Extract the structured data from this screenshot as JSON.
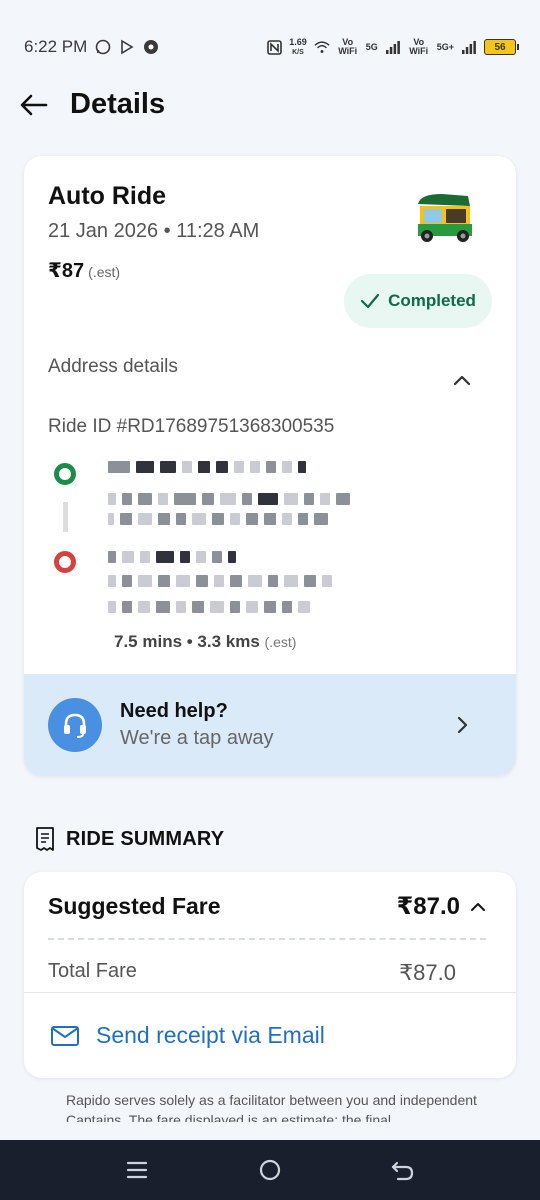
{
  "status_bar": {
    "time": "6:22 PM",
    "net_speed_value": "1.69",
    "net_speed_unit": "K/S",
    "sim1_label": "Vo WiFi",
    "sim1_network": "5G",
    "sim2_label": "Vo WiFi",
    "sim2_network": "5G+",
    "battery": "56"
  },
  "header": {
    "title": "Details"
  },
  "ride": {
    "type": "Auto Ride",
    "datetime": "21 Jan 2026 • 11:28 AM",
    "price": "₹87",
    "price_note": "(.est)",
    "status": "Completed",
    "address_label": "Address details",
    "ride_id": "Ride ID #RD17689751368300535",
    "duration_distance": "7.5 mins • 3.3 kms",
    "duration_note": "(.est)"
  },
  "help": {
    "title": "Need help?",
    "subtitle": "We're a tap away"
  },
  "summary": {
    "heading": "RIDE SUMMARY",
    "suggested_fare_label": "Suggested Fare",
    "suggested_fare_value": "₹87.0",
    "total_fare_label": "Total Fare",
    "total_fare_value": "₹87.0",
    "email_label": "Send receipt via Email"
  },
  "disclaimer": "Rapido serves solely as a facilitator between you and independent Captains. The fare displayed is an estimate; the final",
  "colors": {
    "pickup": "#1a8d4a",
    "drop": "#d64040",
    "completed": "#0d6b4a",
    "accent": "#1f6fc5",
    "help_bg": "#dbeaf9"
  }
}
